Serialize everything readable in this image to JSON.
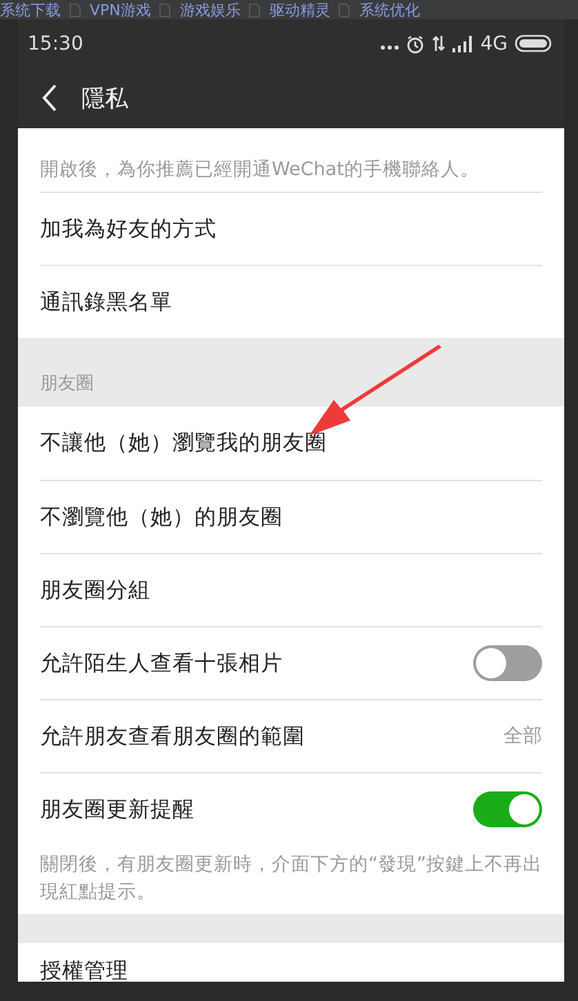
{
  "bookmarks": [
    {
      "label": "系统下载"
    },
    {
      "label": "VPN游戏"
    },
    {
      "label": "游戏娱乐"
    },
    {
      "label": "驱动精灵"
    },
    {
      "label": "系统优化"
    }
  ],
  "status_bar": {
    "time": "15:30",
    "network": "4G"
  },
  "header": {
    "title": "隱私"
  },
  "items": [
    {
      "kind": "hint",
      "text": "開啟後，為你推薦已經開通WeChat的手機聯絡人。"
    },
    {
      "kind": "link",
      "label": "加我為好友的方式"
    },
    {
      "kind": "link",
      "label": "通訊錄黑名單"
    },
    {
      "kind": "section",
      "label": "朋友圈"
    },
    {
      "kind": "link",
      "label": "不讓他（她）瀏覽我的朋友圈"
    },
    {
      "kind": "link",
      "label": "不瀏覽他（她）的朋友圈"
    },
    {
      "kind": "link",
      "label": "朋友圈分組"
    },
    {
      "kind": "toggle",
      "label": "允許陌生人查看十張相片",
      "on": false
    },
    {
      "kind": "value",
      "label": "允許朋友查看朋友圈的範圍",
      "value": "全部"
    },
    {
      "kind": "toggle",
      "label": "朋友圈更新提醒",
      "on": true
    },
    {
      "kind": "hint",
      "text": "關閉後，有朋友圈更新時，介面下方的“發現”按鍵上不再出現紅點提示。"
    },
    {
      "kind": "spacer"
    },
    {
      "kind": "link",
      "label": "授權管理"
    }
  ]
}
